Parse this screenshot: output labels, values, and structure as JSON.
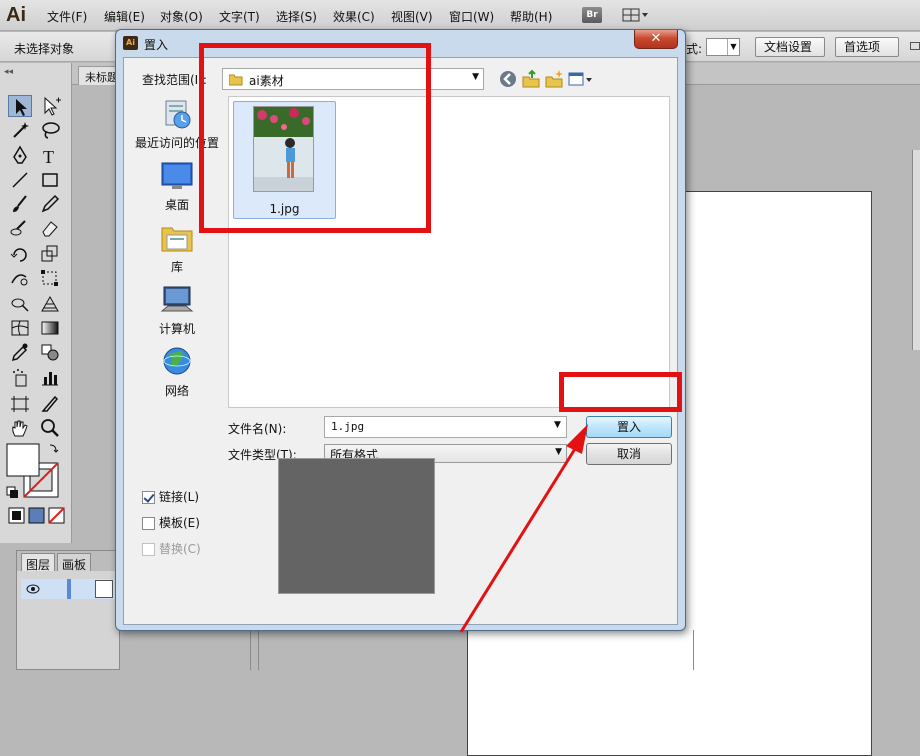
{
  "app": {
    "logo": "Ai",
    "menu": [
      "文件(F)",
      "编辑(E)",
      "对象(O)",
      "文字(T)",
      "选择(S)",
      "效果(C)",
      "视图(V)",
      "窗口(W)",
      "帮助(H)"
    ],
    "bridge_label": "Br"
  },
  "control_bar": {
    "selection_status": "未选择对象",
    "style_label": "式:",
    "doc_setup_label": "文档设置",
    "preferences_label": "首选项"
  },
  "document": {
    "tab_title": "未标题"
  },
  "layers_panel": {
    "tabs": [
      "图层",
      "画板"
    ]
  },
  "dialog": {
    "title": "置入",
    "close_label": "✕",
    "look_in_label": "查找范围(I):",
    "look_in_value": "ai素材",
    "places": [
      "最近访问的位置",
      "桌面",
      "库",
      "计算机",
      "网络"
    ],
    "files": [
      {
        "name": "1.jpg"
      }
    ],
    "file_name_label": "文件名(N):",
    "file_name_value": "1.jpg",
    "file_type_label": "文件类型(T):",
    "file_type_value": "所有格式",
    "place_button": "置入",
    "cancel_button": "取消",
    "options": {
      "link": {
        "label": "链接(L)",
        "checked": true,
        "enabled": true
      },
      "template": {
        "label": "模板(E)",
        "checked": false,
        "enabled": true
      },
      "replace": {
        "label": "替换(C)",
        "checked": false,
        "enabled": false
      }
    }
  },
  "annotation": {
    "color": "#e31212"
  }
}
